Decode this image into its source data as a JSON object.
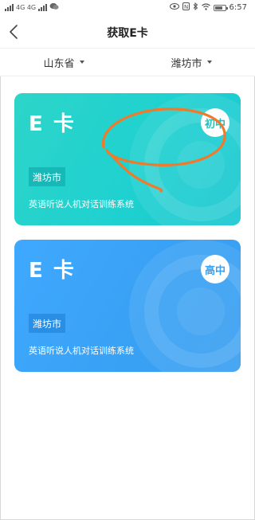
{
  "status_bar": {
    "left_text": "4G 4G",
    "time": "6:57"
  },
  "nav": {
    "title": "获取E卡",
    "back_icon": "chevron-left-icon"
  },
  "filters": {
    "province": "山东省",
    "city": "潍坊市"
  },
  "cards": [
    {
      "title": "E 卡",
      "level": "初中",
      "city": "潍坊市",
      "subtitle": "英语听说人机对话训练系统",
      "color": "#22d2cc"
    },
    {
      "title": "E 卡",
      "level": "高中",
      "city": "潍坊市",
      "subtitle": "英语听说人机对话训练系统",
      "color": "#3ba3f6"
    }
  ],
  "annotation_color": "#f07a2a"
}
